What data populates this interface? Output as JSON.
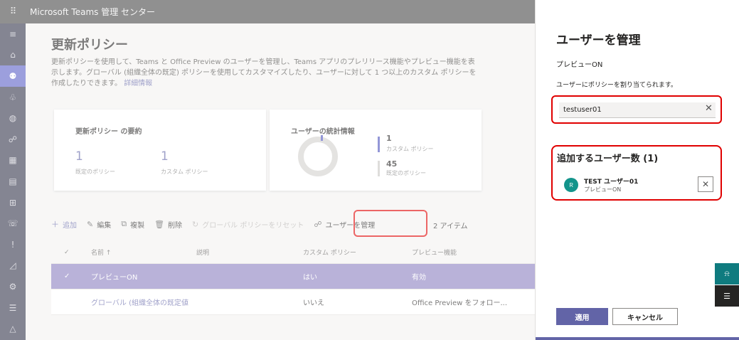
{
  "app": {
    "title": "Microsoft Teams 管理 センター",
    "waffle_icon": "⠿"
  },
  "rail": [
    {
      "icon": "≡",
      "name": "menu-icon"
    },
    {
      "icon": "⌂",
      "name": "home-icon"
    },
    {
      "icon": "⚉",
      "name": "teams-icon"
    },
    {
      "icon": "♧",
      "name": "deploy-icon"
    },
    {
      "icon": "◍",
      "name": "globe-icon"
    },
    {
      "icon": "☍",
      "name": "users-icon"
    },
    {
      "icon": "▦",
      "name": "meetings-icon"
    },
    {
      "icon": "▤",
      "name": "messaging-icon"
    },
    {
      "icon": "⊞",
      "name": "apps-icon"
    },
    {
      "icon": "☏",
      "name": "voice-icon"
    },
    {
      "icon": "!",
      "name": "policy-packages-icon"
    },
    {
      "icon": "◿",
      "name": "analytics-icon"
    },
    {
      "icon": "⚙",
      "name": "settings-icon"
    },
    {
      "icon": "☰",
      "name": "planning-icon"
    },
    {
      "icon": "△",
      "name": "notifications-icon"
    }
  ],
  "page": {
    "title": "更新ポリシー",
    "description": "更新ポリシーを使用して、Teams と Office Preview のユーザーを管理し、Teams アプリのプレリリース機能やプレビュー機能を表示します。グローバル (組織全体の既定) ポリシーを使用してカスタマイズしたり、ユーザーに対して 1 つ以上のカスタム ポリシーを作成したりできます。",
    "learn_more": "詳細情報"
  },
  "summary": {
    "title": "更新ポリシー の要約",
    "default_count": "1",
    "default_label": "既定のポリシー",
    "custom_count": "1",
    "custom_label": "カスタム ポリシー"
  },
  "user_stats": {
    "title": "ユーザーの統計情報",
    "custom_count": "1",
    "custom_label": "カスタム ポリシー",
    "default_count": "45",
    "default_label": "既定のポリシー"
  },
  "toolbar": {
    "add": "追加",
    "edit": "編集",
    "copy": "複製",
    "delete": "削除",
    "reset": "グローバル ポリシーをリセット",
    "manage_users": "ユーザーを管理",
    "item_count": "2 アイテム"
  },
  "table": {
    "headers": {
      "name": "名前 ↑",
      "description": "説明",
      "custom": "カスタム ポリシー",
      "preview": "プレビュー機能"
    },
    "rows": [
      {
        "name": "プレビューON",
        "description": "",
        "custom": "はい",
        "preview": "有効"
      },
      {
        "name": "グローバル (組織全体の既定値",
        "description": "",
        "custom": "いいえ",
        "preview": "Office Preview をフォロー..."
      }
    ]
  },
  "panel": {
    "title": "ユーザーを管理",
    "policy_name": "プレビューON",
    "hint": "ユーザーにポリシーを割り当てられます。",
    "search_value": "testuser01",
    "added_title": "追加するユーザー数 (1)",
    "user": {
      "initial": "Ｒ",
      "name": "TEST ユーザー01",
      "policy": "プレビューON"
    },
    "apply": "適用",
    "cancel": "キャンセル"
  },
  "colors": {
    "accent": "#6264a7",
    "highlight": "#e00000",
    "rail": "#33344a"
  }
}
